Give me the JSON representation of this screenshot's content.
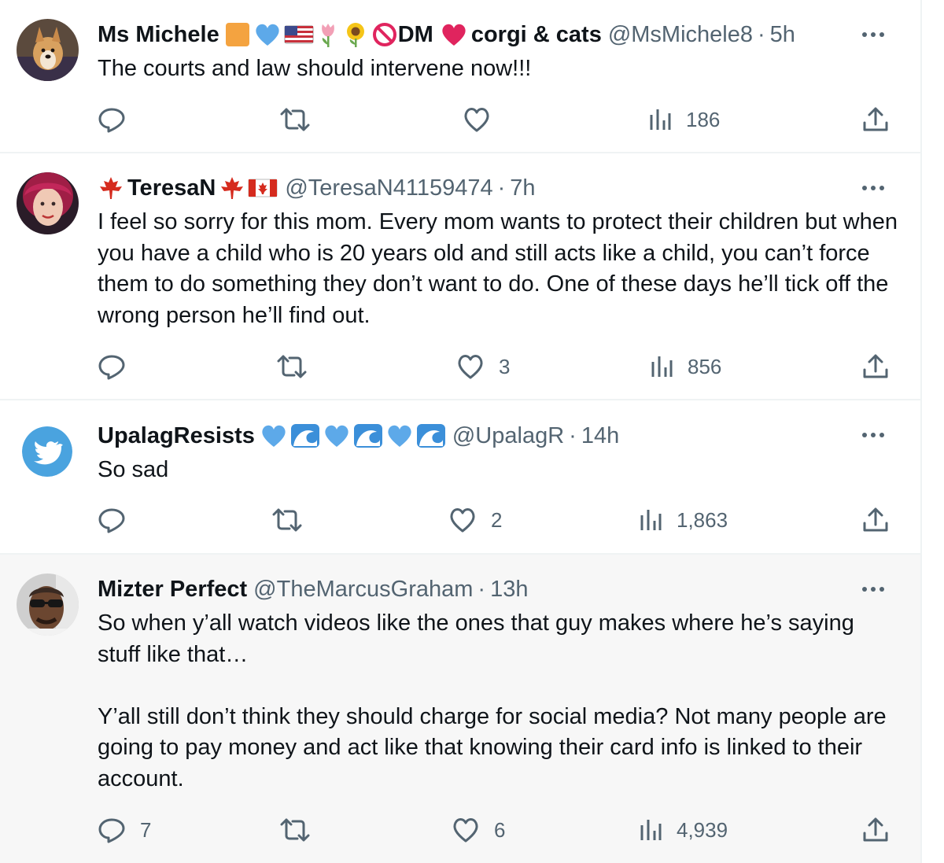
{
  "tweets": [
    {
      "name": "Ms Michele",
      "name_suffix_text": "DM",
      "name_suffix_text2": "corgi & cats",
      "handle": "@MsMichele8",
      "separator": "·",
      "time": "5h",
      "text": "The courts and law should intervene now!!!",
      "replies": "",
      "retweets": "",
      "likes": "",
      "views": "186",
      "avatar": "corgi-photo"
    },
    {
      "name": "TeresaN",
      "handle": "@TeresaN41159474",
      "separator": "·",
      "time": "7h",
      "text": "I feel so sorry for this mom. Every mom wants to protect their children but when you have a child who is 20 years old and still acts like a child, you can’t force them to do something they don’t want to do. One of these days he’ll tick off the wrong person he’ll find out.",
      "replies": "",
      "retweets": "",
      "likes": "3",
      "views": "856",
      "avatar": "woman-red-hair-photo"
    },
    {
      "name": "UpalagResists",
      "handle": "@UpalagR",
      "separator": "·",
      "time": "14h",
      "text": "So sad",
      "replies": "",
      "retweets": "",
      "likes": "2",
      "views": "1,863",
      "avatar": "default-twitter-bird"
    },
    {
      "name": "Mizter Perfect",
      "handle": "@TheMarcusGraham",
      "separator": "·",
      "time": "13h",
      "text": "So when y’all watch videos like the ones that guy makes where he’s saying stuff like that…\n\nY’all still don’t think they should charge for social media? Not many people are going to pay money and act like that knowing their card info is linked to their account.",
      "replies": "7",
      "retweets": "",
      "likes": "6",
      "views": "4,939",
      "avatar": "man-sunglasses-photo"
    }
  ],
  "icons": {
    "reply": "reply-icon",
    "retweet": "retweet-icon",
    "like": "heart-icon",
    "views": "views-icon",
    "share": "share-icon",
    "more": "more-icon"
  },
  "colors": {
    "text_primary": "#0f1419",
    "text_secondary": "#536471",
    "divider": "#eff3f4",
    "highlight_bg": "#f7f7f7",
    "heart_emoji": "#e0245e",
    "blue_heart": "#5da9e9",
    "twitter_blue": "#1d9bf0"
  }
}
